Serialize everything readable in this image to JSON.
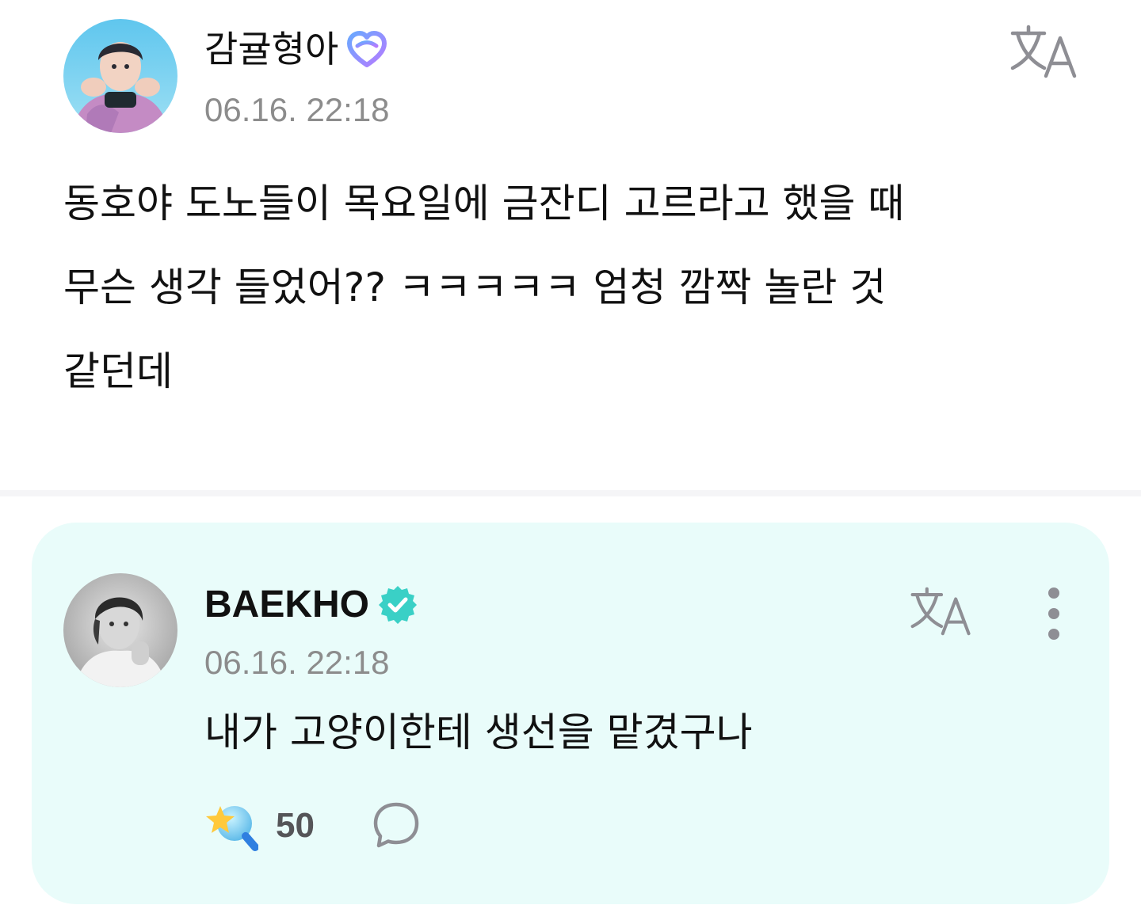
{
  "post": {
    "author": {
      "name": "감귤형아",
      "badge_icon": "heart-badge-icon",
      "avatar_icon": "user-avatar-photo"
    },
    "timestamp": "06.16. 22:18",
    "translate_icon": "translate-icon",
    "body_lines": [
      "동호야 도노들이 목요일에 금잔디 고르라고 했을 때",
      "무슨 생각 들었어?? ㅋㅋㅋㅋㅋ 엄청 깜짝 놀란 것",
      "같던데"
    ]
  },
  "comment": {
    "author": {
      "name": "BAEKHO",
      "badge_icon": "verified-badge-icon",
      "avatar_icon": "artist-avatar-photo"
    },
    "timestamp": "06.16. 22:18",
    "translate_icon": "translate-icon",
    "more_icon": "more-vertical-icon",
    "text": "내가 고양이한테 생선을 맡겼구나",
    "reaction": {
      "icon": "star-lightstick-icon",
      "count": "50"
    },
    "reply_icon": "speech-bubble-icon"
  },
  "colors": {
    "card_background": "#e9fcfa",
    "timestamp": "#8c8c8c",
    "verified_badge": "#3ad0c6",
    "heart_badge_start": "#6aa8ff",
    "heart_badge_end": "#b57bff"
  }
}
